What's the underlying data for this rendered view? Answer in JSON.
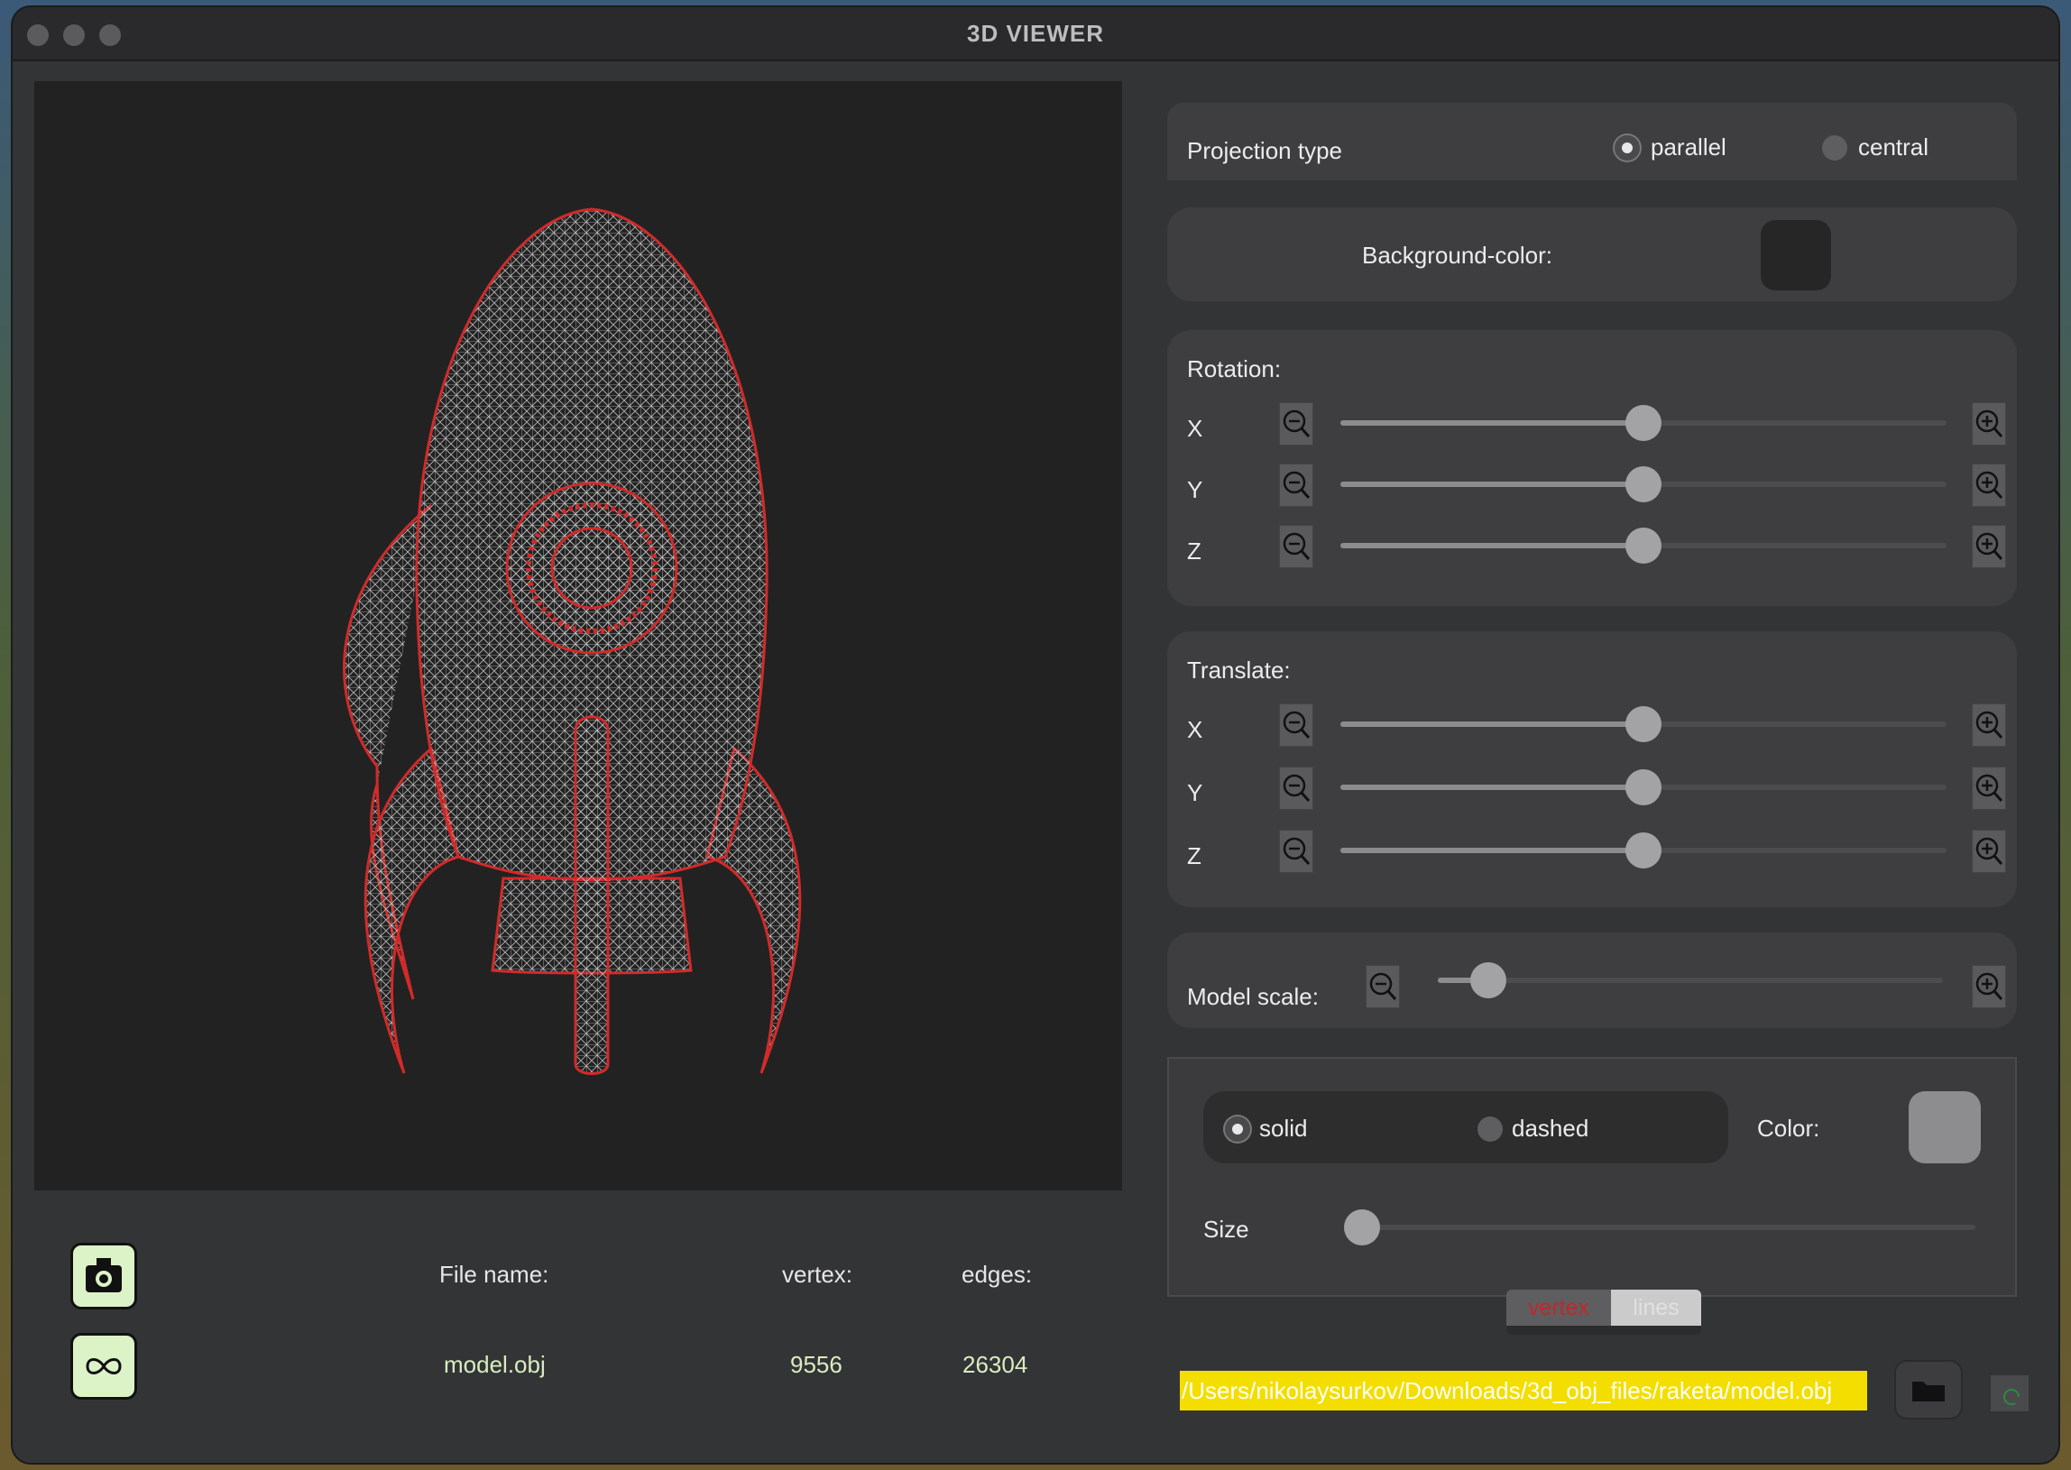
{
  "window": {
    "title": "3D VIEWER"
  },
  "viewport": {
    "model_line_color": "#d22a2a",
    "background": "#222222"
  },
  "file_info": {
    "file_name_label": "File name:",
    "vertex_label": "vertex:",
    "edges_label": "edges:",
    "file_name": "model.obj",
    "vertex_count": "9556",
    "edges_count": "26304"
  },
  "toolbar": {
    "screenshot_icon": "camera-icon",
    "gif_icon": "infinity-icon"
  },
  "projection": {
    "label": "Projection type",
    "options": [
      "parallel",
      "central"
    ],
    "selected": "parallel"
  },
  "background": {
    "label": "Background-color:",
    "color": "#262626"
  },
  "rotation": {
    "title": "Rotation:",
    "axes": [
      {
        "label": "X",
        "value": 0.5
      },
      {
        "label": "Y",
        "value": 0.5
      },
      {
        "label": "Z",
        "value": 0.5
      }
    ]
  },
  "translate": {
    "title": "Translate:",
    "axes": [
      {
        "label": "X",
        "value": 0.5
      },
      {
        "label": "Y",
        "value": 0.5
      },
      {
        "label": "Z",
        "value": 0.5
      }
    ]
  },
  "scale": {
    "label": "Model scale:",
    "value": 0.1
  },
  "line_style": {
    "options": [
      "solid",
      "dashed"
    ],
    "selected": "solid",
    "color_label": "Color:",
    "color": "#8d8d8f",
    "size_label": "Size",
    "size_value": 0.0
  },
  "mode_tabs": {
    "items": [
      "vertex",
      "lines"
    ],
    "active": "vertex"
  },
  "path": {
    "value": "/Users/nikolaysurkov/Downloads/3d_obj_files/raketa/model.obj"
  },
  "colors": {
    "accent_active": "#c0282a",
    "path_bg": "#f3de00",
    "icon_button_bg": "#dcf3c8"
  }
}
